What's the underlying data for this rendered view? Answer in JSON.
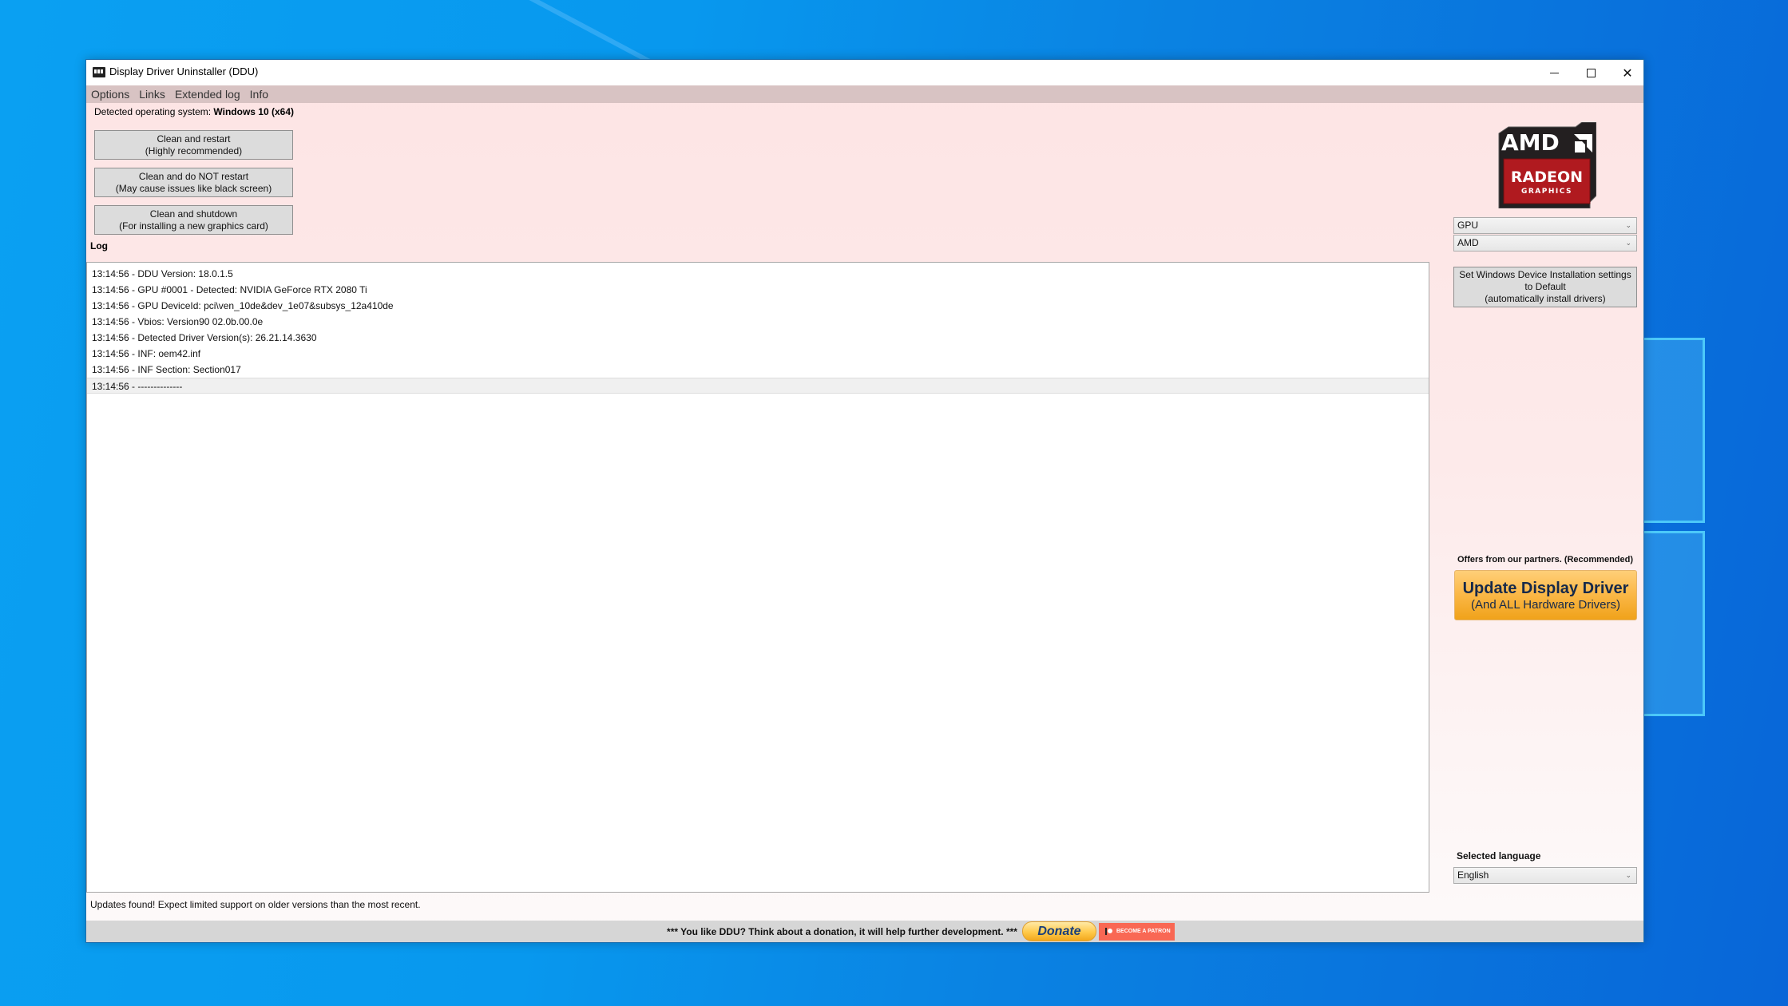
{
  "window": {
    "title": "Display Driver Uninstaller (DDU)",
    "controls": {
      "minimize": "minimize",
      "maximize": "maximize",
      "close": "close"
    }
  },
  "menu": {
    "items": [
      {
        "label": "Options"
      },
      {
        "label": "Links"
      },
      {
        "label": "Extended log"
      },
      {
        "label": "Info"
      }
    ]
  },
  "os": {
    "label": "Detected operating system:",
    "value": "Windows 10 (x64)"
  },
  "actions": {
    "clean_restart": {
      "line1": "Clean and restart",
      "line2": "(Highly recommended)"
    },
    "clean_no_restart": {
      "line1": "Clean and do NOT restart",
      "line2": "(May cause issues like black screen)"
    },
    "clean_shutdown": {
      "line1": "Clean and shutdown",
      "line2": "(For installing a new graphics card)"
    }
  },
  "log": {
    "label": "Log",
    "entries": [
      "13:14:56 - DDU Version: 18.0.1.5",
      "13:14:56 - GPU #0001 - Detected: NVIDIA GeForce RTX 2080 Ti",
      "13:14:56 - GPU DeviceId: pci\\ven_10de&dev_1e07&subsys_12a410de",
      "13:14:56 - Vbios: Version90 02.0b.00.0e",
      "13:14:56 - Detected Driver Version(s): 26.21.14.3630",
      "13:14:56 - INF: oem42.inf",
      "13:14:56 - INF Section: Section017",
      "13:14:56 - --------------"
    ],
    "selected_index": 7
  },
  "status": {
    "message": "Updates found! Expect limited support on older versions than the most recent."
  },
  "donation": {
    "text": "*** You like DDU? Think about a donation, it will help further development. ***",
    "donate_label": "Donate",
    "patron_label": "BECOME A PATRON"
  },
  "right_panel": {
    "logo": {
      "brand": "AMD",
      "line1": "RADEON",
      "line2": "GRAPHICS"
    },
    "device_type": {
      "selected": "GPU"
    },
    "vendor": {
      "selected": "AMD"
    },
    "set_default": {
      "line1": "Set Windows Device Installation settings",
      "line2": "to Default",
      "line3": "(automatically install drivers)"
    },
    "offers_label": "Offers from our partners. (Recommended)",
    "update_button": {
      "main": "Update Display Driver",
      "sub": "(And ALL Hardware Drivers)"
    },
    "language": {
      "label": "Selected language",
      "selected": "English"
    }
  },
  "colors": {
    "window_bg_top": "#fde4e4",
    "menubar_bg": "#d8c3c3",
    "update_orange": "#f0a21a",
    "patron_red": "#f96854",
    "desktop_blue": "#0a8ce8"
  }
}
